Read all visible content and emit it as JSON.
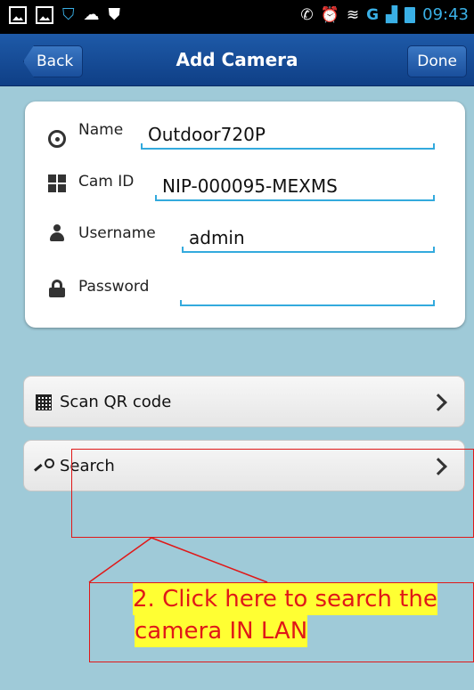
{
  "status_bar": {
    "time": "09:43",
    "network_type": "G",
    "left_icons": [
      "gallery-icon",
      "image-icon",
      "security-bag-icon",
      "cloud-icon",
      "shield-icon"
    ],
    "right_icons": [
      "mute-icon",
      "alarm-icon",
      "wifi-icon",
      "signal-icon",
      "battery-icon"
    ]
  },
  "nav": {
    "back_label": "Back",
    "title": "Add Camera",
    "done_label": "Done"
  },
  "form": {
    "name": {
      "label": "Name",
      "value": "Outdoor720P",
      "icon": "webcam-icon"
    },
    "cam_id": {
      "label": "Cam ID",
      "value": "NIP-000095-MEXMS",
      "icon": "grid-icon"
    },
    "username": {
      "label": "Username",
      "value": "admin",
      "icon": "user-icon"
    },
    "password": {
      "label": "Password",
      "value": "",
      "icon": "lock-icon"
    }
  },
  "list": {
    "scan_label": "Scan QR code",
    "search_label": "Search"
  },
  "annotation": {
    "line1": "2. Click here to search the",
    "line2": "camera IN LAN",
    "color": "#e01818",
    "highlight": "#ffff33"
  },
  "colors": {
    "background": "#9fcad8",
    "nav_bar": "#1e5aa8",
    "field_underline": "#33aadd"
  }
}
